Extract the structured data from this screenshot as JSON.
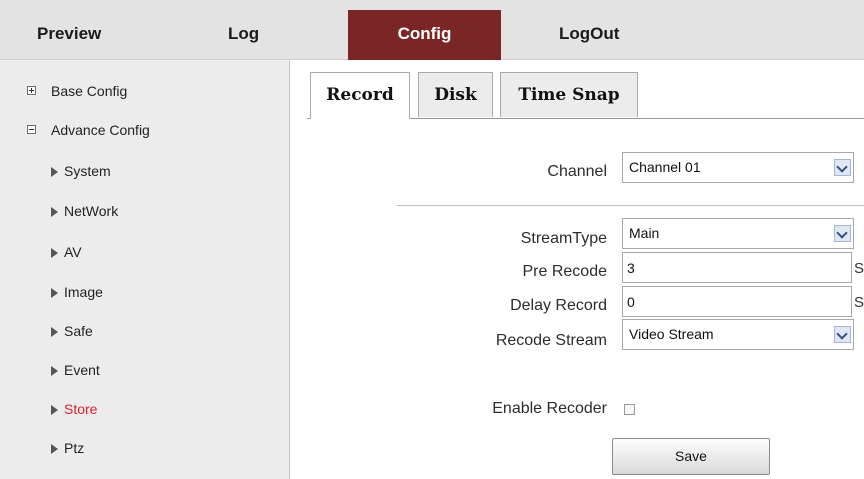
{
  "nav": {
    "preview": "Preview",
    "log": "Log",
    "config": "Config",
    "logout": "LogOut",
    "active_color": "#7b2626"
  },
  "sidebar": {
    "base_config": "Base Config",
    "advance_config": "Advance Config",
    "items": [
      {
        "label": "System"
      },
      {
        "label": "NetWork"
      },
      {
        "label": "AV"
      },
      {
        "label": "Image"
      },
      {
        "label": "Safe"
      },
      {
        "label": "Event"
      },
      {
        "label": "Store"
      },
      {
        "label": "Ptz"
      }
    ],
    "active_item": "Store",
    "active_color": "#e0202a"
  },
  "tabs": {
    "record": "Record",
    "disk": "Disk",
    "time_snap": "Time Snap",
    "active": "Record"
  },
  "form": {
    "channel_label": "Channel",
    "channel_value": "Channel 01",
    "stream_type_label": "StreamType",
    "stream_type_value": "Main",
    "pre_record_label": "Pre Recode",
    "pre_record_value": "3",
    "pre_record_unit": "S",
    "delay_record_label": "Delay Record",
    "delay_record_value": "0",
    "delay_record_unit": "S",
    "record_stream_label": "Recode Stream",
    "record_stream_value": "Video Stream",
    "enable_label": "Enable Recoder",
    "enable_checked": false,
    "save_label": "Save"
  }
}
